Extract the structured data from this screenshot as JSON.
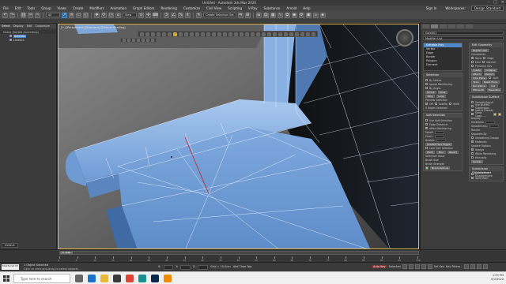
{
  "window": {
    "title": "Untitled - Autodesk 3ds Max 2020",
    "controls": [
      "–",
      "□",
      "✕"
    ]
  },
  "menu": {
    "items": [
      "File",
      "Edit",
      "Tools",
      "Group",
      "Views",
      "Create",
      "Modifiers",
      "Animation",
      "Graph Editors",
      "Rendering",
      "Customize",
      "Civil View",
      "Scripting",
      "V-Ray",
      "Substance",
      "Arnold",
      "Help"
    ],
    "sign_in": "Sign In",
    "workspaces_label": "Workspaces:",
    "workspace_value": "Design Standard"
  },
  "toolbar": {
    "view_dropdown": "View",
    "selection_set": "Create Selection Set"
  },
  "explorer": {
    "tabs": [
      "Select",
      "Display",
      "Edit",
      "Customize"
    ],
    "header": "Name (Sorted Ascending)",
    "items": [
      {
        "name": "Sofa001",
        "selected": true
      },
      {
        "name": "Line001",
        "selected": false
      }
    ],
    "layer_dropdown": "Default"
  },
  "viewport": {
    "label": "[+] [Perspective] [Standard] [Default Shading]"
  },
  "command_panel": {
    "object_name": "Sofa001",
    "modifier_list": "Modifier List",
    "stack": [
      {
        "label": "Editable Poly",
        "selected": true
      },
      {
        "label": "Vertex",
        "selected": false
      },
      {
        "label": "Edge",
        "selected": false
      },
      {
        "label": "Border",
        "selected": false
      },
      {
        "label": "Polygon",
        "selected": false
      },
      {
        "label": "Element",
        "selected": false
      }
    ],
    "rollouts": {
      "selection": {
        "title": "Selection",
        "by_vertex": "By Vertex",
        "ignore_backfacing": "Ignore Backfacing",
        "by_angle": "By Angle:",
        "shrink": "Shrink",
        "grow": "Grow",
        "ring": "Ring",
        "loop": "Loop",
        "preview_selection": "Preview Selection",
        "off": "Off",
        "subobj": "SubObj",
        "multi": "Multi",
        "status": "0 Edges Selected"
      },
      "soft_selection": {
        "title": "Soft Selection",
        "use_soft": "Use Soft Selection",
        "edge_distance": "Edge Distance:",
        "affect_backfacing": "Affect Backfacing",
        "falloff": "Falloff:",
        "pinch": "Pinch:",
        "bubble": "Bubble:",
        "shaded_face_toggle": "Shaded Face Toggle",
        "lock_soft": "Lock Soft Selection",
        "paint": "Paint",
        "blur": "Blur",
        "revert": "Revert",
        "selection_value": "Selection Value",
        "brush_size": "Brush Size",
        "brush_strength": "Brush Strength",
        "brush_options": "Brush Options"
      },
      "edit_geometry": {
        "title": "Edit Geometry",
        "repeat_last": "Repeat Last",
        "constraints": "Constraints",
        "none": "None",
        "edge": "Edge",
        "face": "Face",
        "normal": "Normal",
        "preserve_uvs": "Preserve UVs",
        "create": "Create",
        "collapse": "Collapse",
        "attach": "Attach",
        "detach": "Detach",
        "slice_plane": "Slice Plane",
        "split": "Split",
        "slice": "Slice",
        "reset_plane": "Reset Plane",
        "quickslice": "QuickSlice",
        "cut": "Cut",
        "meshsmooth": "MSmooth",
        "tessellate": "Tessellate"
      },
      "subdivision_surface": {
        "title": "Subdivision Surface",
        "smooth_result": "Smooth Result",
        "use_nurms": "Use NURMS Subdivision",
        "isoline_display": "Isoline Display",
        "show_cage": "Show Cage......",
        "display": "Display",
        "iterations": "Iterations:",
        "smoothness": "Smoothness:",
        "render": "Render",
        "separate_by": "Separate By",
        "smoothing_groups": "Smoothing Groups",
        "materials": "Materials",
        "update_options": "Update Options",
        "always": "Always",
        "when_rendering": "When Rendering",
        "manually": "Manually",
        "update": "Update"
      },
      "subdivision_displacement": {
        "title": "Subdivision Displacement",
        "subdiv_disp": "Subdivision Displacement",
        "split_mesh": "Split Mesh"
      }
    }
  },
  "timeline": {
    "frame_display": "0 / 100",
    "ticks": [
      "0",
      "5",
      "10",
      "15",
      "20",
      "25",
      "30",
      "35",
      "40",
      "45",
      "50",
      "55",
      "60",
      "65",
      "70",
      "75",
      "80",
      "85",
      "90",
      "95",
      "100"
    ]
  },
  "status": {
    "maxscript": "MAXScript Mi",
    "selected": "1 Object Selected",
    "prompt": "Click or click-and-drag to select objects",
    "x": "X:",
    "y": "Y:",
    "z": "Z:",
    "grid": "Grid = 10.0cm",
    "add_time_tag": "Add Time Tag",
    "auto_key": "Auto Key",
    "selected_mode": "Selected",
    "set_key": "Set Key",
    "key_filters": "Key Filters..."
  },
  "taskbar": {
    "search_placeholder": "Type here to search",
    "time": "1:59 PM",
    "date": "6/3/2020",
    "apps": [
      {
        "icon": "task-view-icon",
        "color": "#666666"
      },
      {
        "icon": "edge-icon",
        "color": "#1a73c9"
      },
      {
        "icon": "folder-icon",
        "color": "#e8b93a"
      },
      {
        "icon": "store-icon",
        "color": "#3a3a3a"
      },
      {
        "icon": "chrome-icon",
        "color": "#db4437"
      },
      {
        "icon": "3dsmax-icon",
        "color": "#1a8f8f"
      },
      {
        "icon": "photoshop-icon",
        "color": "#0a2a4a"
      },
      {
        "icon": "vlc-icon",
        "color": "#f08a00"
      }
    ]
  }
}
